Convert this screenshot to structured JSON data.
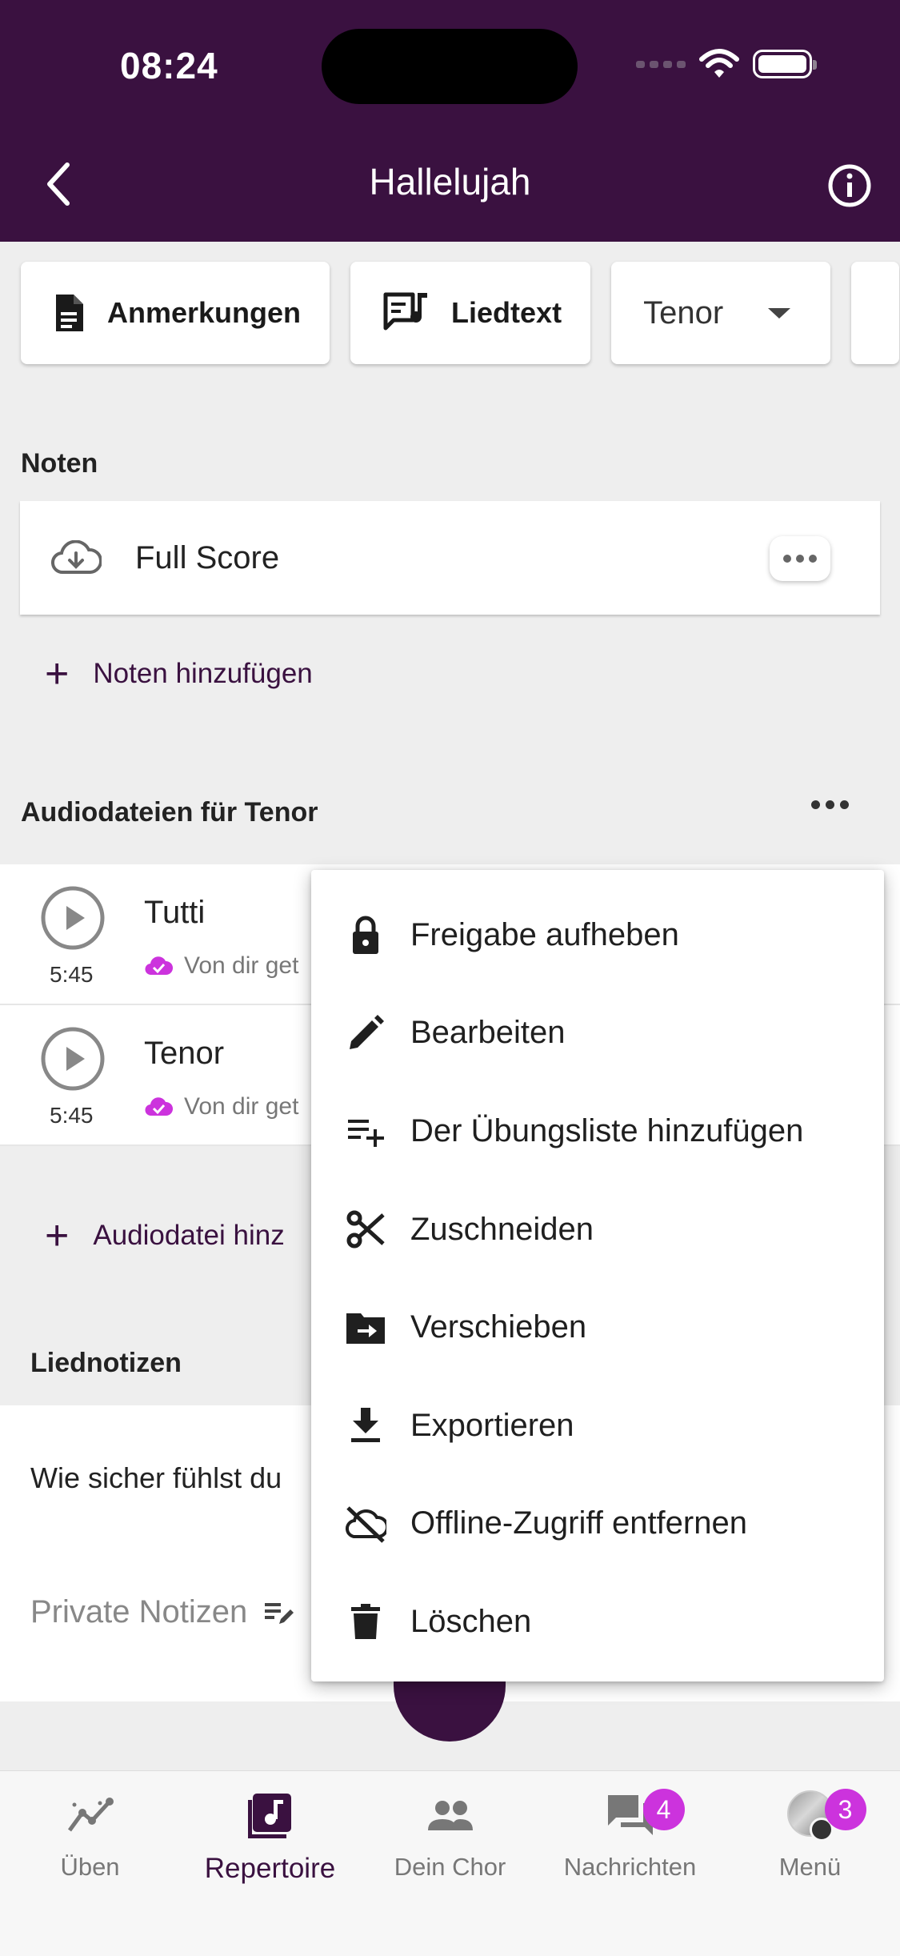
{
  "status_bar": {
    "time": "08:24"
  },
  "header": {
    "title": "Hallelujah"
  },
  "chips": [
    {
      "label": "Anmerkungen",
      "icon": "document-icon"
    },
    {
      "label": "Liedtext",
      "icon": "lyrics-icon"
    },
    {
      "label": "Tenor",
      "icon": "dropdown-arrow-icon"
    }
  ],
  "noten": {
    "title": "Noten",
    "items": [
      {
        "name": "Full Score",
        "icon": "cloud-download-icon"
      }
    ],
    "add_label": "Noten hinzufügen"
  },
  "audio": {
    "title": "Audiodateien für Tenor",
    "items": [
      {
        "title": "Tutti",
        "duration": "5:45",
        "shared": "Von dir get"
      },
      {
        "title": "Tenor",
        "duration": "5:45",
        "shared": "Von dir get"
      }
    ],
    "add_label": "Audiodatei hinz"
  },
  "song_notes": {
    "title": "Liednotizen",
    "question": "Wie sicher fühlst du",
    "private_notes": "Private Notizen"
  },
  "context_menu": {
    "items": [
      {
        "label": "Freigabe aufheben",
        "icon": "lock-icon"
      },
      {
        "label": "Bearbeiten",
        "icon": "pencil-icon"
      },
      {
        "label": "Der Übungsliste hinzufügen",
        "icon": "playlist-add-icon"
      },
      {
        "label": "Zuschneiden",
        "icon": "scissors-icon"
      },
      {
        "label": "Verschieben",
        "icon": "folder-move-icon"
      },
      {
        "label": "Exportieren",
        "icon": "download-icon"
      },
      {
        "label": "Offline-Zugriff entfernen",
        "icon": "cloud-off-icon"
      },
      {
        "label": "Löschen",
        "icon": "trash-icon"
      }
    ]
  },
  "bottom_nav": {
    "items": [
      {
        "label": "Üben",
        "icon": "chart-line-icon"
      },
      {
        "label": "Repertoire",
        "icon": "music-note-icon",
        "active": true
      },
      {
        "label": "Dein Chor",
        "icon": "group-icon"
      },
      {
        "label": "Nachrichten",
        "icon": "chat-icon",
        "badge": "4"
      },
      {
        "label": "Menü",
        "icon": "avatar",
        "badge": "3"
      }
    ]
  },
  "colors": {
    "brand": "#3a1140",
    "accent": "#cc33dd",
    "background": "#eeeeee"
  }
}
